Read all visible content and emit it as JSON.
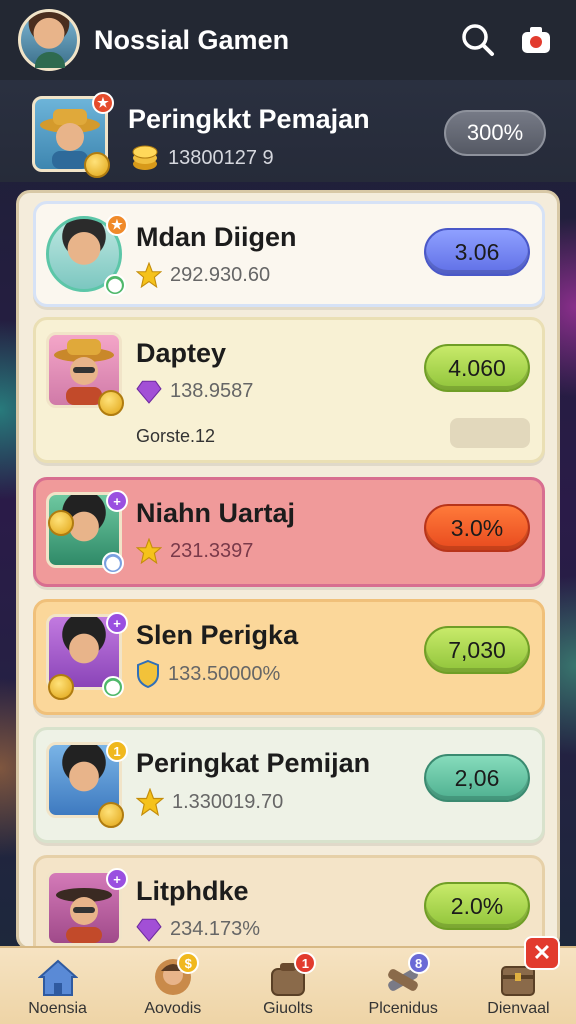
{
  "app": {
    "title": "Nossial Gamen"
  },
  "header": {
    "title": "Peringkkt Pemajan",
    "coins": "13800127 9",
    "percent": "300%"
  },
  "players": [
    {
      "name": "Mdan Diigen",
      "score": "292.930.60",
      "value": "3.06",
      "sub_icon": "star-icon",
      "badge": "rank-icon"
    },
    {
      "name": "Daptey",
      "score": "138.9587",
      "value": "4.060",
      "sub_icon": "gem-icon",
      "extra": "Gorste.12"
    },
    {
      "name": "Niahn Uartaj",
      "score": "231.3397",
      "value": "3.0%",
      "sub_icon": "star-icon"
    },
    {
      "name": "Slen Perigka",
      "score": "133.50000%",
      "value": "7,030",
      "sub_icon": "shield-icon"
    },
    {
      "name": "Peringkat Pemijan",
      "score": "1.330019.70",
      "value": "2,06",
      "sub_icon": "star-icon"
    },
    {
      "name": "Litphdke",
      "score": "234.173%",
      "value": "2.0%",
      "sub_icon": "gem-icon"
    }
  ],
  "nav": [
    {
      "label": "Noensia",
      "icon": "home-icon"
    },
    {
      "label": "Aovodis",
      "icon": "profile-icon",
      "badge": "$"
    },
    {
      "label": "Giuolts",
      "icon": "bag-icon",
      "badge": "1"
    },
    {
      "label": "Plcenidus",
      "icon": "tools-icon",
      "badge": "8"
    },
    {
      "label": "Dienvaal",
      "icon": "chest-icon"
    }
  ],
  "colors": {
    "blue": "#6e7ff0",
    "green": "#a6d64a",
    "orange": "#f05a2a",
    "teal": "#62c6a6"
  }
}
